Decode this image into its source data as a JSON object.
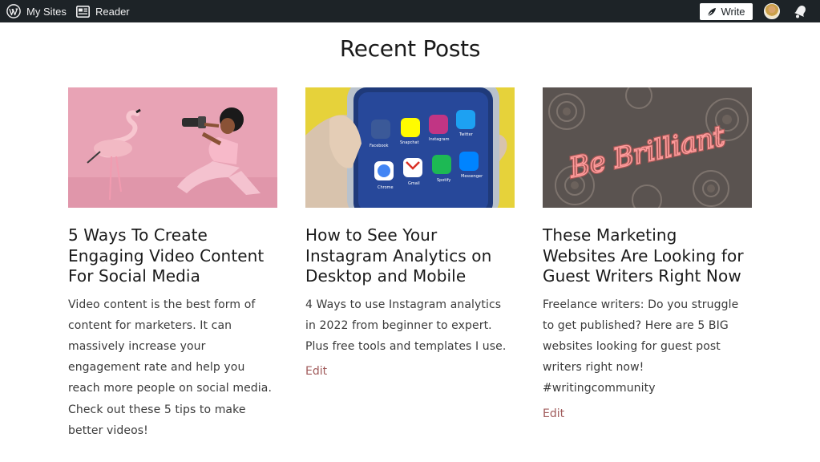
{
  "adminbar": {
    "my_sites_label": "My Sites",
    "reader_label": "Reader",
    "write_label": "Write"
  },
  "page": {
    "title": "Recent Posts"
  },
  "posts": [
    {
      "title": "5 Ways To Create Engaging Video Content For Social Media",
      "excerpt": "Video content is the best form of content for marketers. It can massively increase your engagement rate and help you reach more people on social media. Check out these 5 tips to make better videos!"
    },
    {
      "title": "How to See Your Instagram Analytics on Desktop and Mobile",
      "excerpt": "4 Ways to use Instagram analytics in 2022 from beginner to expert. Plus free tools and templates I use.",
      "edit_label": "Edit",
      "app_labels": [
        "Facebook",
        "Snapchat",
        "Instagram",
        "Twitter",
        "Chrome",
        "Gmail",
        "Spotify",
        "Messenger"
      ]
    },
    {
      "title": "These Marketing Websites Are Looking for Guest Writers Right Now",
      "excerpt": "Freelance writers: Do you struggle to get published? Here are 5 BIG websites looking for guest post writers right now! #writingcommunity",
      "edit_label": "Edit",
      "neon_text": "Be Brilliant"
    }
  ],
  "colors": {
    "adminbar_bg": "#1d2327",
    "edit_link": "#a05a5a",
    "card1_bg": "#e8a3b5",
    "card2_bg": "#e6d23a",
    "card3_neon": "#ff5a5a"
  },
  "icons": {
    "wordpress": "wordpress-icon",
    "reader": "reader-icon",
    "write": "pen-icon",
    "notifications": "bell-icon"
  }
}
